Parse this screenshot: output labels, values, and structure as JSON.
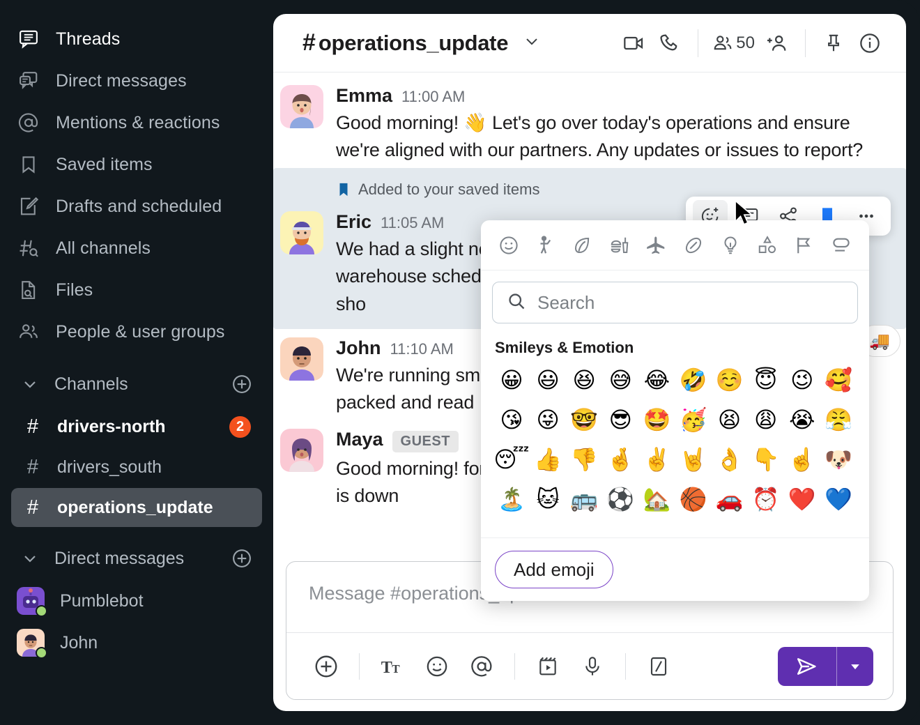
{
  "sidebar": {
    "nav": [
      {
        "label": "Threads",
        "icon": "threads-icon"
      },
      {
        "label": "Direct messages",
        "icon": "direct-messages-icon"
      },
      {
        "label": "Mentions & reactions",
        "icon": "at-icon"
      },
      {
        "label": "Saved items",
        "icon": "bookmark-icon"
      },
      {
        "label": "Drafts and scheduled",
        "icon": "draft-pencil-icon"
      },
      {
        "label": "All channels",
        "icon": "channel-search-icon"
      },
      {
        "label": "Files",
        "icon": "file-search-icon"
      },
      {
        "label": "People & user groups",
        "icon": "people-icon"
      }
    ],
    "channels_section": {
      "title": "Channels",
      "add_label": "+"
    },
    "channels": [
      {
        "hash": "#",
        "name": "drivers-north",
        "badge": "2",
        "state": "unread"
      },
      {
        "hash": "#",
        "name": "drivers_south",
        "badge": "",
        "state": "normal"
      },
      {
        "hash": "#",
        "name": "operations_update",
        "badge": "",
        "state": "selected"
      }
    ],
    "dms_section": {
      "title": "Direct messages",
      "add_label": "+"
    },
    "dms": [
      {
        "name": "Pumblebot",
        "presence": "online"
      },
      {
        "name": "John",
        "presence": "online"
      }
    ]
  },
  "header": {
    "hash": "#",
    "channel": "operations_update",
    "member_count": "50",
    "buttons": [
      "video-call-icon",
      "phone-call-icon",
      "members-icon",
      "add-member-icon",
      "pin-icon",
      "info-icon"
    ]
  },
  "messages": [
    {
      "author": "Emma",
      "time": "11:00 AM",
      "tag": "",
      "text": "Good morning! 👋 Let's go over today's operations and ensure we're aligned with our partners. Any updates or issues to report?"
    },
    {
      "author": "Eric",
      "time": "11:05 AM",
      "tag": "",
      "saved_notice": "Added to your saved items",
      "text": "We had a slight north warehouse schedule. It sho"
    },
    {
      "author": "John",
      "time": "11:10 AM",
      "tag": "",
      "text": "We're running sm packed and read"
    },
    {
      "author": "Maya",
      "time": "",
      "tag": "GUEST",
      "text": "Good morning! forklifts is down"
    }
  ],
  "hover_toolbar": {
    "buttons": [
      "add-reaction-icon",
      "reply-in-thread-icon",
      "share-message-icon",
      "saved-bookmark-icon",
      "more-actions-icon"
    ]
  },
  "reaction_chip": {
    "emoji": "🚚",
    "count": ""
  },
  "emoji_picker": {
    "categories": [
      "smileys-category-icon",
      "people-category-icon",
      "nature-category-icon",
      "food-category-icon",
      "travel-category-icon",
      "activities-category-icon",
      "objects-category-icon",
      "symbols-category-icon",
      "flags-category-icon",
      "custom-category-icon"
    ],
    "search_placeholder": "Search",
    "section_title": "Smileys & Emotion",
    "rows": [
      [
        "😀",
        "😃",
        "😆",
        "😅",
        "😂",
        "🤣",
        "☺️",
        "😇",
        "😉",
        "🥰"
      ],
      [
        "😘",
        "😜",
        "🤓",
        "😎",
        "🤩",
        "🥳",
        "😫",
        "😩",
        "😭",
        "😤"
      ],
      [
        "😴",
        "👍",
        "👎",
        "🤞",
        "✌️",
        "🤘",
        "👌",
        "👇",
        "☝️",
        "🐶"
      ],
      [
        "🏝️",
        "🐱",
        "🚌",
        "⚽",
        "🏡",
        "🏀",
        "🚗",
        "⏰",
        "❤️",
        "💙"
      ]
    ],
    "add_emoji_label": "Add emoji"
  },
  "composer": {
    "placeholder": "Message #operations_update",
    "tools": [
      "plus-icon",
      "text-format-icon",
      "emoji-icon",
      "mention-icon",
      "video-clip-icon",
      "audio-clip-icon",
      "slash-command-icon"
    ],
    "send_label": "send-icon",
    "send_caret": "send-options-caret-icon"
  },
  "colors": {
    "sidebar_bg": "#11181d",
    "accent_purple": "#5f2fb0",
    "badge_orange": "#f4511e",
    "saved_blue": "#1264a3",
    "saved_row_bg": "#e3e9ee"
  }
}
